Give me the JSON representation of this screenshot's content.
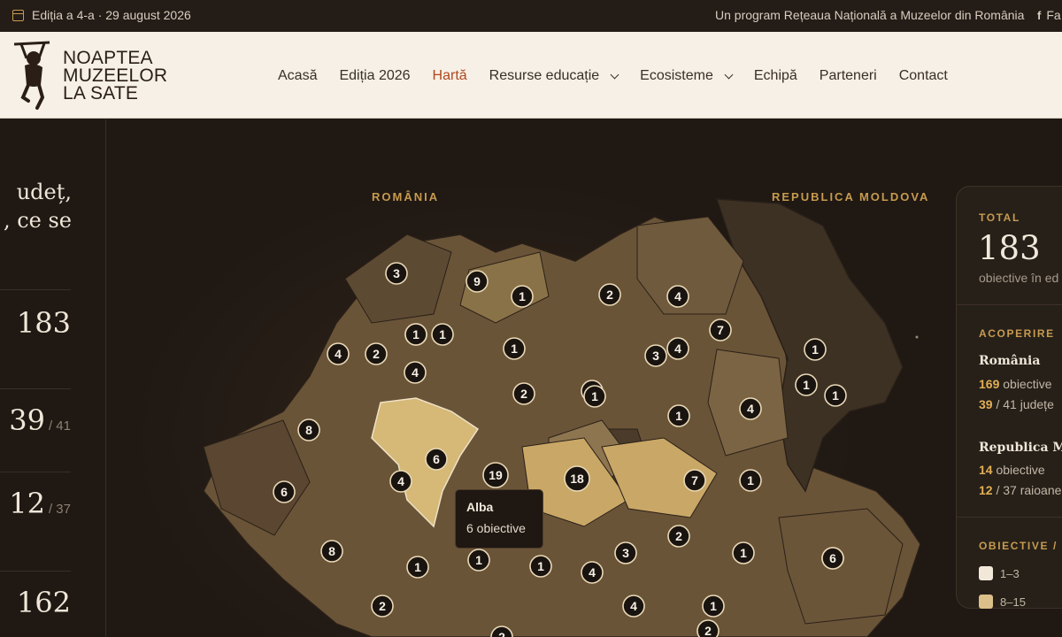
{
  "topbar": {
    "edition": "Ediția a 4-a · 29 august 2026",
    "program": "Un program Rețeaua Națională a Muzeelor din România",
    "social": "Fa"
  },
  "logo": {
    "line1": "NOAPTEA",
    "line2": "MUZEELOR",
    "line3": "LA SATE"
  },
  "nav": [
    {
      "label": "Acasă"
    },
    {
      "label": "Ediția 2026"
    },
    {
      "label": "Hartă",
      "active": true
    },
    {
      "label": "Resurse educație",
      "dropdown": true
    },
    {
      "label": "Ecosisteme",
      "dropdown": true
    },
    {
      "label": "Echipă"
    },
    {
      "label": "Parteneri"
    },
    {
      "label": "Contact"
    }
  ],
  "left": {
    "headline_line1": "udeț,",
    "headline_line2": ", ce se",
    "stats": [
      {
        "value": "183",
        "of": ""
      },
      {
        "value": "39",
        "of": "/ 41"
      },
      {
        "value": "12",
        "of": "/ 37"
      },
      {
        "value": "162",
        "of": ""
      }
    ]
  },
  "map": {
    "label_ro": "ROMÂNIA",
    "label_md": "REPUBLICA MOLDOVA",
    "markers": [
      "3",
      "9",
      "4",
      "1",
      "2",
      "1",
      "1",
      "1",
      "4",
      "4",
      "2",
      "4",
      "7",
      "2",
      "1",
      "4",
      "1",
      "4",
      "3",
      "1",
      "1",
      "1",
      "8",
      "1",
      "4",
      "6",
      "19",
      "18",
      "6",
      "7",
      "1",
      "6",
      "8",
      "1",
      "1",
      "1",
      "3",
      "2",
      "1",
      "6",
      "2",
      "4",
      "4",
      "1",
      "2",
      "2"
    ],
    "tooltip": {
      "name": "Alba",
      "count": "6 obiective"
    }
  },
  "panel": {
    "total_label": "TOTAL",
    "total": "183",
    "total_sub": "obiective în ed",
    "coverage_label": "ACOPERIRE",
    "romania": {
      "name": "România",
      "obj_num": "169",
      "obj_txt": " obiective",
      "j_num": "39",
      "j_txt": " / 41 județe"
    },
    "moldova": {
      "name": "Republica Mo",
      "obj_num": "14",
      "obj_txt": " obiective",
      "r_num": "12",
      "r_txt": " / 37 raioane"
    },
    "legend_label": "OBIECTIVE /",
    "legend": [
      {
        "label": "1–3",
        "color": "#f1e8da"
      },
      {
        "label": "8–15",
        "color": "#dcc08a"
      }
    ]
  },
  "colors": {
    "accent": "#c79a4f",
    "active_nav": "#b0471f",
    "highlight": "#d6b877"
  }
}
